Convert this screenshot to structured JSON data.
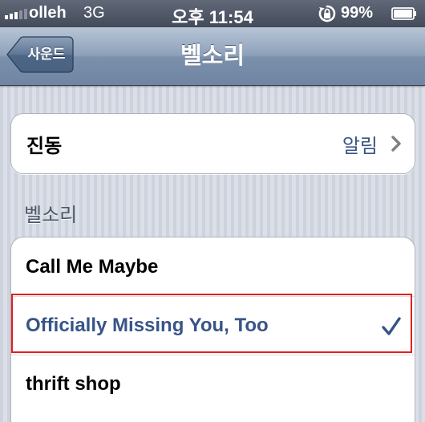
{
  "status_bar": {
    "carrier": "olleh",
    "network": "3G",
    "time": "오후 11:54",
    "battery_percent": "99%",
    "battery_level": 0.99,
    "signal_icon": "signal-bars-icon",
    "lock_icon": "rotation-lock-icon",
    "battery_icon": "battery-icon"
  },
  "nav": {
    "back_label": "사운드",
    "title": "벨소리"
  },
  "vibration": {
    "label": "진동",
    "value": "알림",
    "icon": "chevron-right-icon"
  },
  "ringtones": {
    "section_header": "벨소리",
    "items": [
      {
        "label": "Call Me Maybe",
        "selected": false
      },
      {
        "label": "Officially Missing You, Too",
        "selected": true
      },
      {
        "label": "thrift shop",
        "selected": false
      }
    ],
    "check_icon": "checkmark-icon"
  },
  "colors": {
    "accent": "#385487",
    "highlight_border": "#e02020",
    "nav_bar": "#8ea1ba",
    "status_bar": "#4f5666"
  }
}
